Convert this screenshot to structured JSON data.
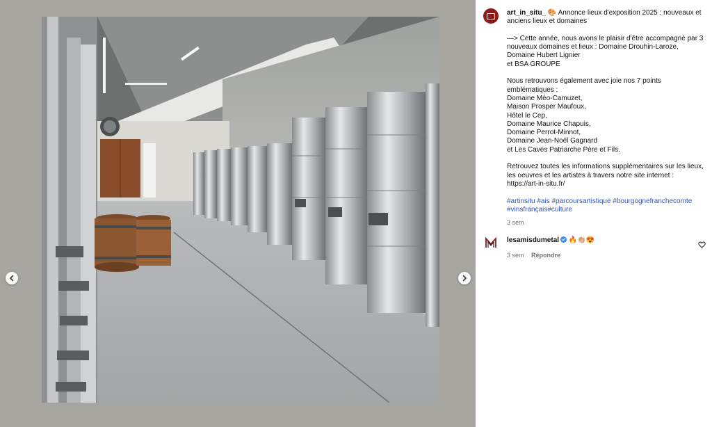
{
  "post": {
    "username": "art_in_situ_",
    "title_emoji": "🎨",
    "title": "Annonce lieux d'exposition 2025 : nouveaux et anciens lieux et domaines",
    "paragraph1": [
      "—> Cette année, nous avons le plaisir d'être accompagné par 3 nouveaux domaines et lieux : Domaine Drouhin-Laroze,",
      "Domaine Hubert Lignier",
      "et BSA GROUPE"
    ],
    "paragraph2": [
      "Nous retrouvons également avec joie nos 7 points emblématiques :",
      "Domaine Méo-Camuzet,",
      "Maison Prosper Maufoux,",
      "Hôtel le Cep,",
      "Domaine Maurice Chapuis,",
      "Domaine Perrot-Minnot,",
      "Domaine Jean-Noël Gagnard",
      "et Les Caves Patriarche Père et Fils."
    ],
    "paragraph3": [
      "Retrouvez toutes les informations supplémentaires sur les lieux, les oeuvres et les artistes à travers notre site internet :",
      "https://art-in-situ.fr/"
    ],
    "hashtags": "#artinsitu #ais #parcoursartistique #bourgognefranchecomte #vinsfrançais#culture",
    "time": "3 sem"
  },
  "comment": {
    "username": "lesamisdumetal",
    "text": "🔥👏🏼😍",
    "time": "3 sem",
    "reply_label": "Répondre"
  },
  "icons": {
    "prev": "chevron-left-icon",
    "next": "chevron-right-icon",
    "like": "heart-icon"
  },
  "colors": {
    "media_background": "#a7a59f",
    "hashtag": "#2d55b8",
    "avatar": "#8b1a1a",
    "verified": "#3a8cf0"
  }
}
